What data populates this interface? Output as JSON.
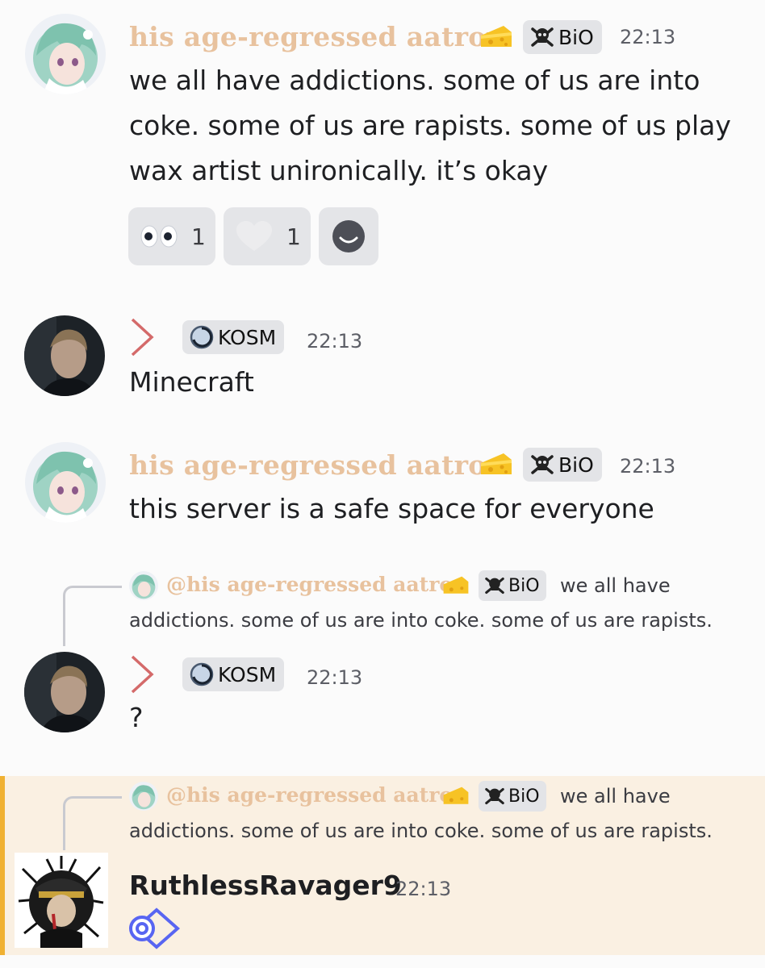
{
  "messages": [
    {
      "author": "his age-regressed aatrox",
      "badge": "BiO",
      "time": "22:13",
      "text": "we all have addictions. some of us are into coke. some of us are rapists. some of us play wax artist unironically. it’s okay",
      "reactions": [
        {
          "emoji": "eyes-emoji",
          "count": "1"
        },
        {
          "emoji": "heart-emoji",
          "count": "1"
        }
      ]
    },
    {
      "author_icon": "chevron-right-icon",
      "badge": "KOSM",
      "time": "22:13",
      "text": "Minecraft"
    },
    {
      "author": "his age-regressed aatrox",
      "badge": "BiO",
      "time": "22:13",
      "text": "this server is a safe space for everyone"
    },
    {
      "reply": {
        "author": "@his age-regressed aatrox",
        "badge": "BiO",
        "text_line1": "we all have",
        "text_line2": "addictions. some of us are into coke. some of us are rapists."
      },
      "badge": "KOSM",
      "time": "22:13",
      "text": "?"
    },
    {
      "reply": {
        "author": "@his age-regressed aatrox",
        "badge": "BiO",
        "text_line1": "we all have",
        "text_line2": "addictions. some of us are into coke. some of us are rapists."
      },
      "author": "RuthlessRavager9",
      "time": "22:13",
      "highlighted": true
    }
  ],
  "colors": {
    "gothic_name": "#e8c29e",
    "highlight_bg": "#faf0e2",
    "highlight_bar": "#f0b132",
    "chevron": "#d46a6a",
    "badge_bg": "#e3e4e7"
  }
}
